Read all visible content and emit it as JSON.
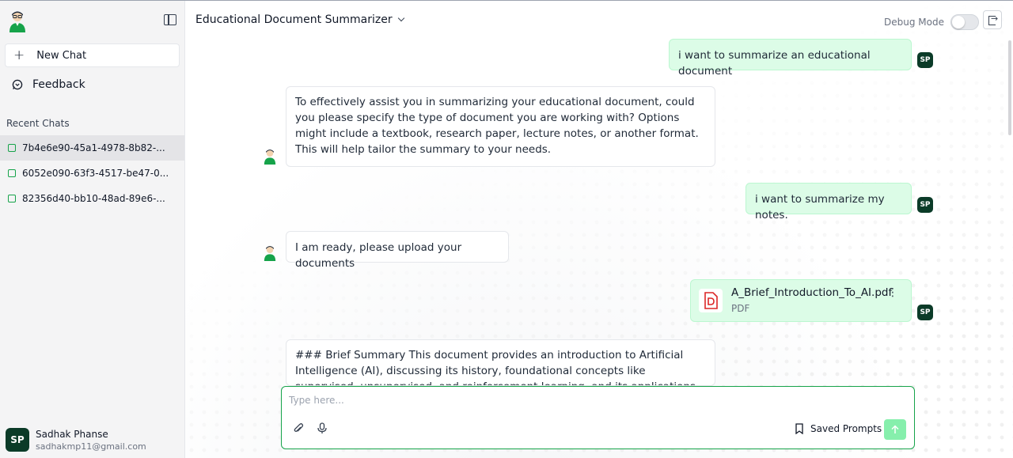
{
  "app": {
    "title": "Educational Document Summarizer",
    "debug_label": "Debug Mode"
  },
  "sidebar": {
    "new_chat": "New Chat",
    "feedback": "Feedback",
    "recent_title": "Recent Chats",
    "chats": [
      "7b4e6e90-45a1-4978-8b82-...",
      "6052e090-63f3-4517-be47-0...",
      "82356d40-bb10-48ad-89e6-..."
    ],
    "user": {
      "initials": "SP",
      "name": "Sadhak Phanse",
      "email": "sadhakmp11@gmail.com"
    }
  },
  "messages": {
    "m1": "i want to summarize an educational document",
    "m2": "To effectively assist you in summarizing your educational document, could you please specify the type of document you are working with? Options might include a textbook, research paper, lecture notes, or another format. This will help tailor the summary to your needs.",
    "m3": "i want to summarize my notes.",
    "m4": "I am ready, please upload your documents",
    "file_name": "A_Brief_Introduction_To_AI.pdf",
    "file_type": "PDF",
    "m6": "### Brief Summary This document provides an introduction to Artificial Intelligence (AI), discussing its history, foundational concepts like supervised, unsupervised, and reinforcement learning, and its applications in various industries. The text delves",
    "user_initials": "SP"
  },
  "composer": {
    "placeholder": "Type here...",
    "saved_prompts": "Saved Prompts"
  },
  "colors": {
    "accent": "#16a34a",
    "user_bubble": "#dcfce7",
    "avatar": "#0b3b28"
  }
}
